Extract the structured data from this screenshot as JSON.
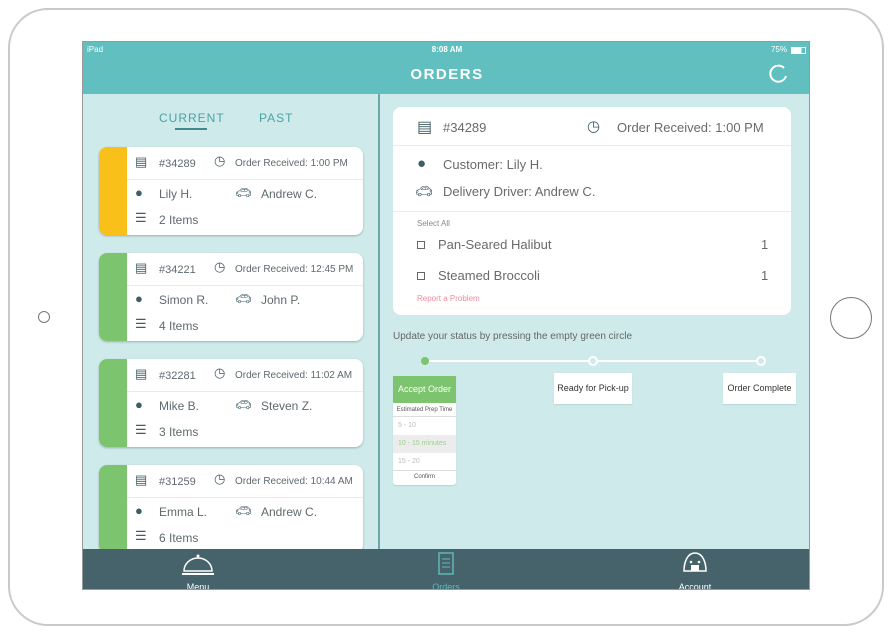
{
  "status_bar": {
    "device": "iPad",
    "time": "8:08 AM",
    "battery": "75%"
  },
  "header": {
    "title": "ORDERS",
    "refresh_icon": "refresh-icon"
  },
  "tabs": [
    {
      "label": "CURRENT",
      "active": true
    },
    {
      "label": "PAST",
      "active": false
    }
  ],
  "orders": [
    {
      "id": "#34289",
      "received": "Order Received: 1:00 PM",
      "customer": "Lily H.",
      "driver": "Andrew C.",
      "items": "2 Items",
      "color": "#f9c01a"
    },
    {
      "id": "#34221",
      "received": "Order Received: 12:45 PM",
      "customer": "Simon R.",
      "driver": "John P.",
      "items": "4 Items",
      "color": "#7dc46e"
    },
    {
      "id": "#32281",
      "received": "Order Received: 11:02 AM",
      "customer": "Mike B.",
      "driver": "Steven Z.",
      "items": "3 Items",
      "color": "#7dc46e"
    },
    {
      "id": "#31259",
      "received": "Order Received: 10:44 AM",
      "customer": "Emma L.",
      "driver": "Andrew C.",
      "items": "6 Items",
      "color": "#7dc46e"
    }
  ],
  "detail": {
    "id": "#34289",
    "received": "Order Received: 1:00 PM",
    "customer": "Customer: Lily H.",
    "driver": "Delivery Driver: Andrew C.",
    "select_all": "Select All",
    "items": [
      {
        "name": "Pan-Seared Halibut",
        "qty": "1"
      },
      {
        "name": "Steamed Broccoli",
        "qty": "1"
      }
    ],
    "report": "Report a Problem"
  },
  "progress": {
    "instruction": "Update your status by pressing the empty green circle",
    "steps": [
      {
        "label": "Accept Order",
        "done": true
      },
      {
        "label": "Ready for Pick-up",
        "done": false
      },
      {
        "label": "Order Complete",
        "done": false
      }
    ],
    "prep_title": "Estimated Prep Time",
    "prep_options": [
      "5 - 10",
      "10 - 15  minutes",
      "15 - 20"
    ],
    "selected": "10 - 15  minutes",
    "confirm": "Confirm"
  },
  "tabbar": [
    {
      "label": "Menu",
      "icon": "cloche-icon"
    },
    {
      "label": "Orders",
      "icon": "orders-icon",
      "active": true
    },
    {
      "label": "Account",
      "icon": "account-icon"
    }
  ],
  "colors": {
    "accent": "#62bfbf",
    "green": "#7dc46e",
    "yellow": "#f9c01a",
    "tabbar": "#46636b",
    "report": "#f28b9b"
  }
}
